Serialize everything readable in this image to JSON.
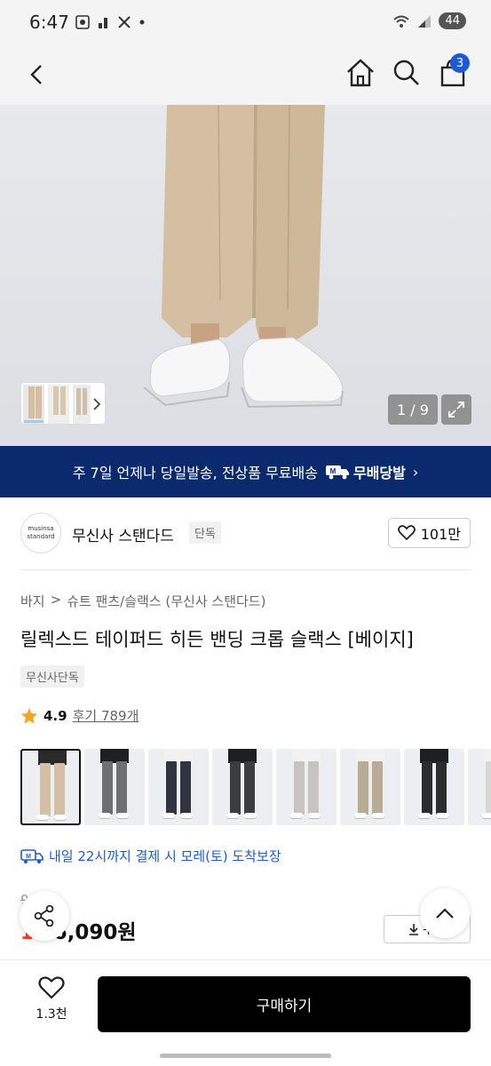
{
  "status_bar": {
    "time": "6:47",
    "battery": "44"
  },
  "header": {
    "cart_count": "3"
  },
  "hero": {
    "counter": "1 / 9"
  },
  "banner": {
    "text": "주 7일 언제나 당일발송, 전상품 무료배송",
    "badge_icon_letter": "M",
    "badge_label": "무배당발",
    "chevron": "›"
  },
  "brand": {
    "logo_line1": "musinsa",
    "logo_line2": "standard",
    "name": "무신사 스탠다드",
    "tag": "단독",
    "likes": "101만"
  },
  "breadcrumb": {
    "level1": "바지",
    "separator": ">",
    "level2": "슈트 팬츠/슬랙스 (무신사 스탠다드)"
  },
  "product": {
    "title": "릴렉스드 테이퍼드 히든 밴딩 크롭 슬랙스 [베이지]",
    "exclusive_tag": "무신사단독",
    "rating": "4.9",
    "reviews": "후기 789개"
  },
  "color_options": [
    {
      "pants": "#d3bfa3",
      "top": "#2a2a2a",
      "selected": true
    },
    {
      "pants": "#6d7073",
      "top": "#1f1f1f",
      "selected": false
    },
    {
      "pants": "#2f3540",
      "top": "#f2f2f2",
      "selected": false
    },
    {
      "pants": "#3b3c3f",
      "top": "#1f1f1f",
      "selected": false
    },
    {
      "pants": "#c6c4bd",
      "top": "#f2f2f2",
      "selected": false
    },
    {
      "pants": "#b9ac95",
      "top": "#f2f2f2",
      "selected": false
    },
    {
      "pants": "#2b2c2e",
      "top": "#1f1f1f",
      "selected": false
    },
    {
      "pants": "#d9d7d2",
      "top": "#f2f2f2",
      "selected": false
    }
  ],
  "delivery": {
    "icon_letter": "M",
    "text": "내일 22시까지 결제 시 모레(토) 도착보장"
  },
  "price": {
    "original": "9 9원",
    "discount": "1",
    "current": "36,090원",
    "coupon_label": "쿠폰"
  },
  "bottom_bar": {
    "wish_count": "1.3천",
    "buy_label": "구매하기"
  },
  "colors": {
    "brand_navy": "#0b2a6e",
    "accent_blue": "#1f5ad6",
    "discount_red": "#ff3a1e",
    "star": "#f5a623"
  }
}
